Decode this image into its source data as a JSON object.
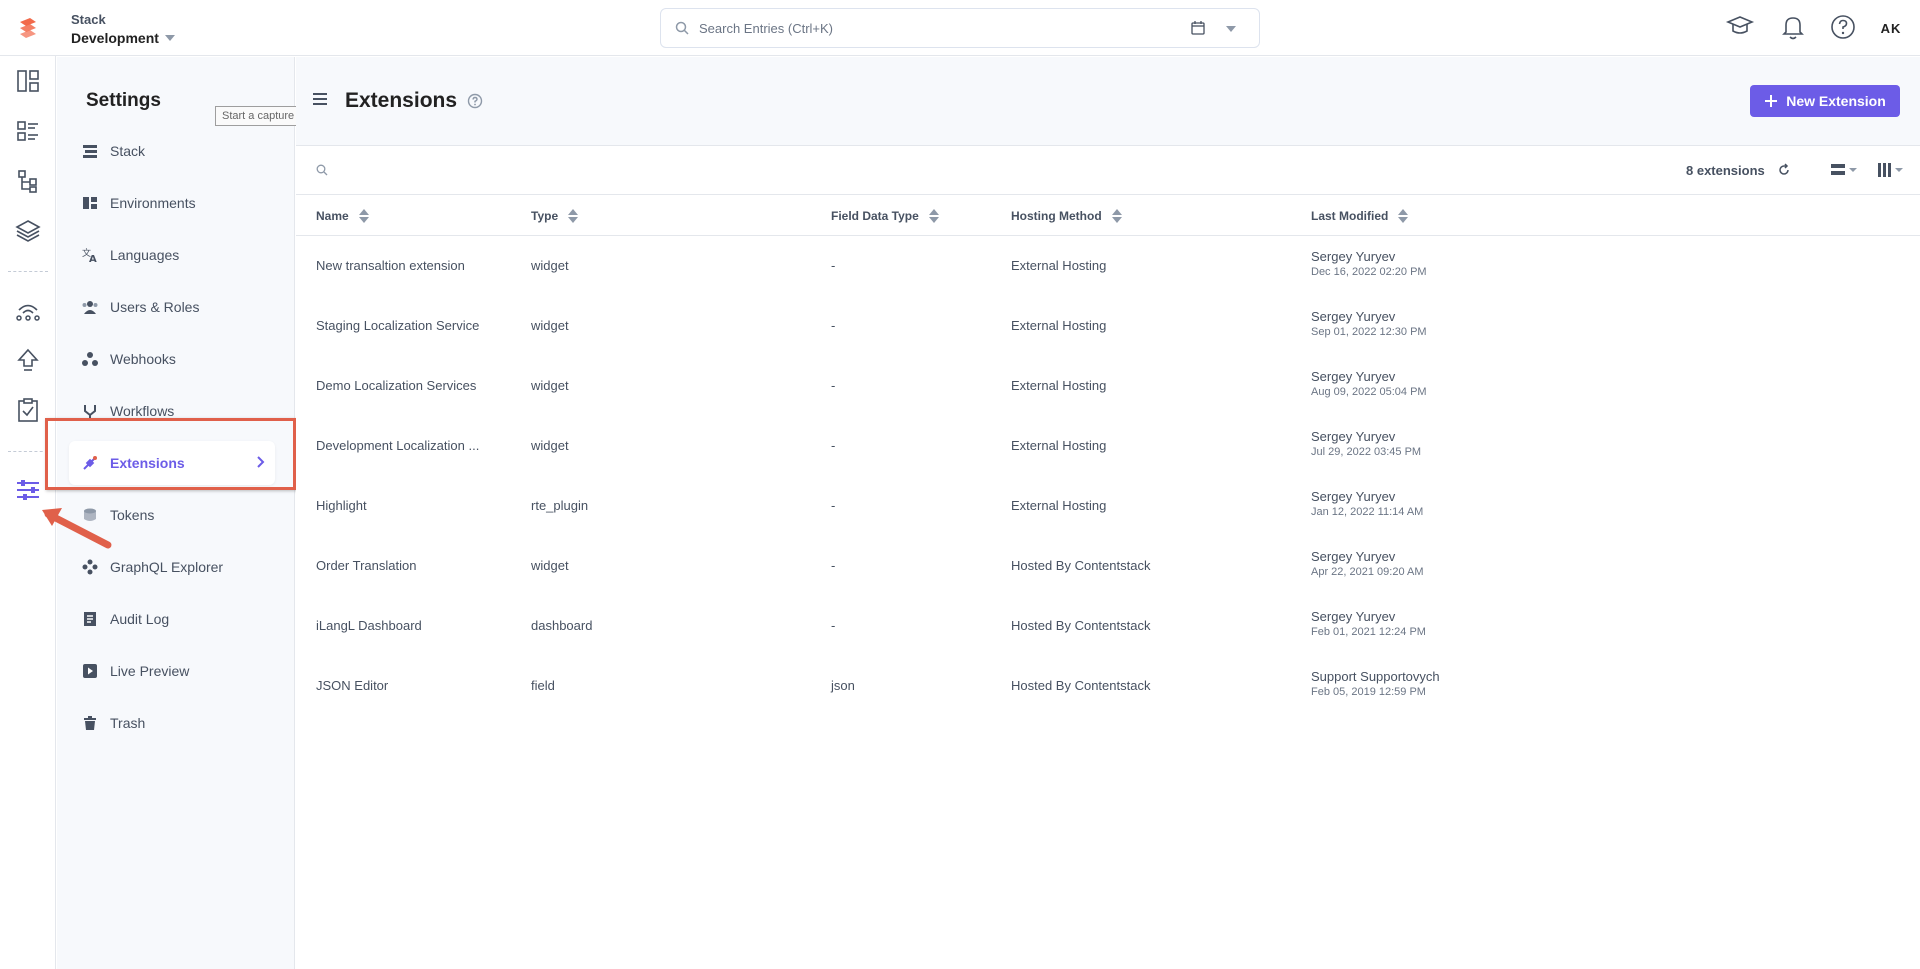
{
  "topbar": {
    "stack_label": "Stack",
    "environment": "Development",
    "search_placeholder": "Search Entries (Ctrl+K)",
    "avatar_initials": "AK"
  },
  "settings": {
    "title": "Settings",
    "tooltip": "Start a capture",
    "items": [
      {
        "label": "Stack",
        "icon": "stack-icon"
      },
      {
        "label": "Environments",
        "icon": "environments-icon"
      },
      {
        "label": "Languages",
        "icon": "languages-icon"
      },
      {
        "label": "Users & Roles",
        "icon": "users-icon"
      },
      {
        "label": "Webhooks",
        "icon": "webhooks-icon"
      },
      {
        "label": "Workflows",
        "icon": "workflows-icon"
      },
      {
        "label": "Extensions",
        "icon": "extensions-icon",
        "active": true
      },
      {
        "label": "Tokens",
        "icon": "tokens-icon"
      },
      {
        "label": "GraphQL Explorer",
        "icon": "graphql-icon"
      },
      {
        "label": "Audit Log",
        "icon": "audit-log-icon"
      },
      {
        "label": "Live Preview",
        "icon": "live-preview-icon"
      },
      {
        "label": "Trash",
        "icon": "trash-icon"
      }
    ]
  },
  "main": {
    "title": "Extensions",
    "new_button": "New Extension",
    "count_label": "8 extensions",
    "columns": [
      "Name",
      "Type",
      "Field Data Type",
      "Hosting Method",
      "Last Modified"
    ],
    "rows": [
      {
        "name": "New transaltion extension",
        "type": "widget",
        "field_type": "-",
        "hosting": "External Hosting",
        "modified_by": "Sergey Yuryev",
        "modified_at": "Dec 16, 2022 02:20 PM"
      },
      {
        "name": "Staging Localization Service",
        "type": "widget",
        "field_type": "-",
        "hosting": "External Hosting",
        "modified_by": "Sergey Yuryev",
        "modified_at": "Sep 01, 2022 12:30 PM"
      },
      {
        "name": "Demo Localization Services",
        "type": "widget",
        "field_type": "-",
        "hosting": "External Hosting",
        "modified_by": "Sergey Yuryev",
        "modified_at": "Aug 09, 2022 05:04 PM"
      },
      {
        "name": "Development Localization ...",
        "type": "widget",
        "field_type": "-",
        "hosting": "External Hosting",
        "modified_by": "Sergey Yuryev",
        "modified_at": "Jul 29, 2022 03:45 PM"
      },
      {
        "name": "Highlight",
        "type": "rte_plugin",
        "field_type": "-",
        "hosting": "External Hosting",
        "modified_by": "Sergey Yuryev",
        "modified_at": "Jan 12, 2022 11:14 AM"
      },
      {
        "name": "Order Translation",
        "type": "widget",
        "field_type": "-",
        "hosting": "Hosted By Contentstack",
        "modified_by": "Sergey Yuryev",
        "modified_at": "Apr 22, 2021 09:20 AM"
      },
      {
        "name": "iLangL Dashboard",
        "type": "dashboard",
        "field_type": "-",
        "hosting": "Hosted By Contentstack",
        "modified_by": "Sergey Yuryev",
        "modified_at": "Feb 01, 2021 12:24 PM"
      },
      {
        "name": "JSON Editor",
        "type": "field",
        "field_type": "json",
        "hosting": "Hosted By Contentstack",
        "modified_by": "Support Supportovych",
        "modified_at": "Feb 05, 2019 12:59 PM"
      }
    ]
  },
  "colors": {
    "accent": "#6c5ce7",
    "annotation": "#e0604a",
    "logo": "#f26a4b"
  }
}
